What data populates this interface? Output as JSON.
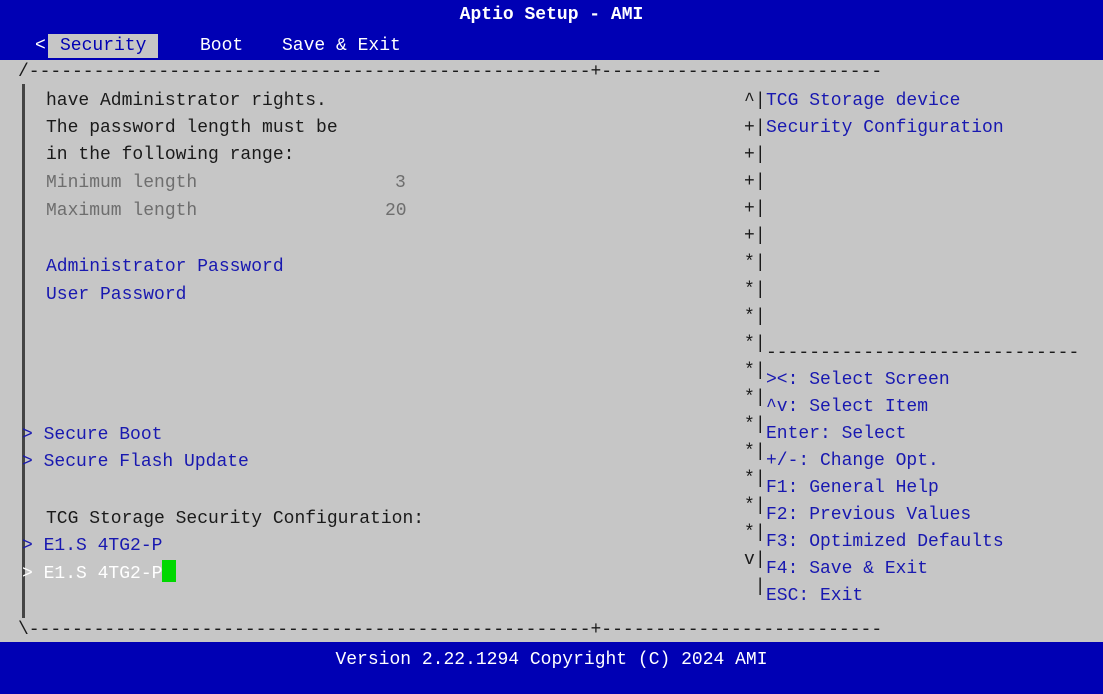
{
  "title": "Aptio Setup - AMI",
  "menu": {
    "scroll_left": "<",
    "tabs": [
      "Security",
      "Boot",
      "Save & Exit"
    ]
  },
  "main": {
    "desc": [
      "have Administrator rights.",
      "The password length must be",
      "in the following range:"
    ],
    "min_label": "Minimum length",
    "min_value": "3",
    "max_label": "Maximum length",
    "max_value": "20",
    "admin_password": "Administrator Password",
    "user_password": "User Password",
    "secure_boot": "Secure Boot",
    "secure_flash": "Secure Flash Update",
    "tcg_heading": "TCG Storage Security Configuration:",
    "drive1": "E1.S 4TG2-P",
    "drive2": "E1.S 4TG2-P"
  },
  "help": {
    "lines": [
      "TCG Storage device",
      "Security Configuration"
    ],
    "keys": [
      "><: Select Screen",
      "^v: Select Item",
      "Enter: Select",
      "+/-: Change Opt.",
      "F1: General Help",
      "F2: Previous Values",
      "F3: Optimized Defaults",
      "F4: Save & Exit",
      "ESC: Exit"
    ]
  },
  "scroll_marks": [
    "^",
    "+",
    "+",
    "+",
    "+",
    "+",
    "*",
    "*",
    "*",
    "*",
    "*",
    "*",
    "*",
    "*",
    "*",
    "*",
    "*",
    "v"
  ],
  "footer": "Version 2.22.1294 Copyright (C) 2024 AMI",
  "colors": {
    "bar_blue": "#0000b4",
    "body_gray": "#c6c6c6",
    "item_blue": "#1818b0",
    "cursor_green": "#00d800"
  }
}
